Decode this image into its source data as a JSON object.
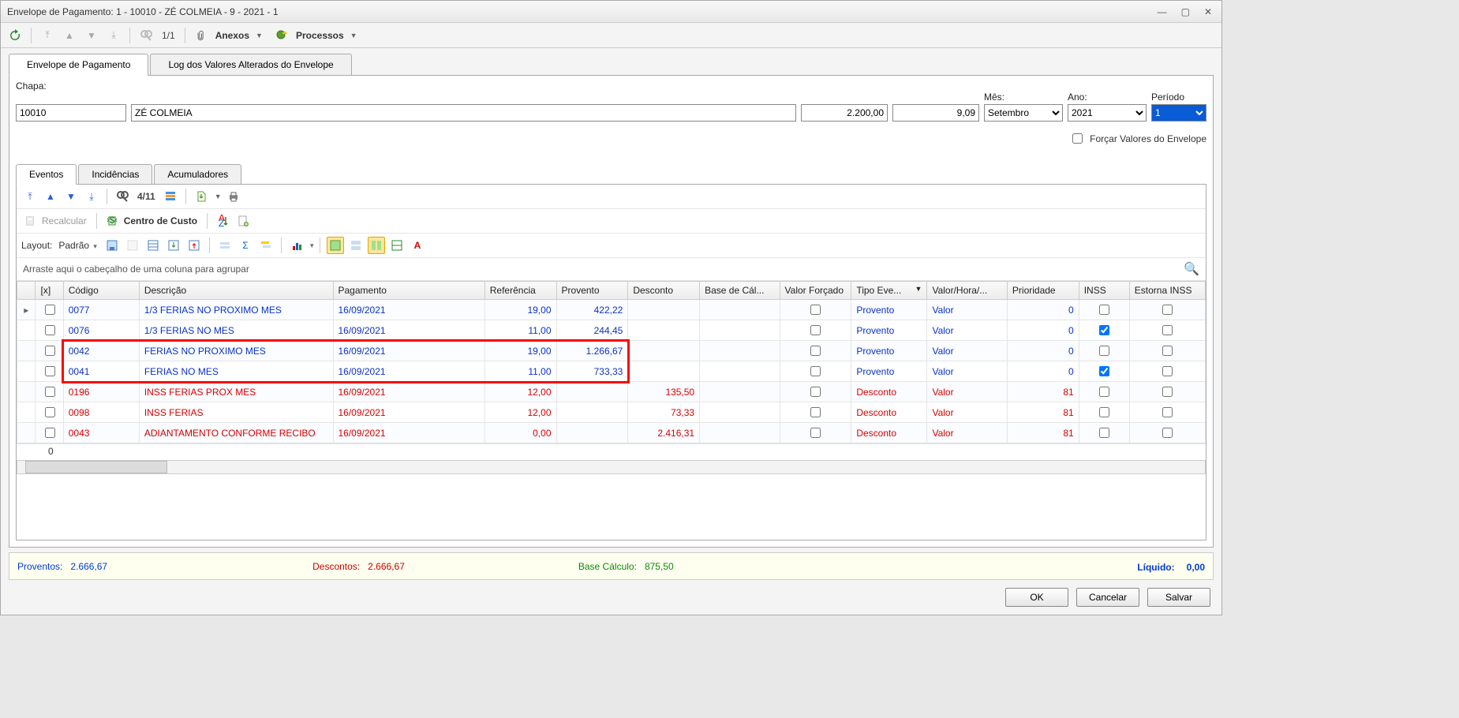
{
  "window": {
    "title": "Envelope de Pagamento: 1 - 10010 - ZÉ COLMEIA - 9 - 2021 - 1"
  },
  "toolbar": {
    "page_indicator": "1/1",
    "anexos_label": "Anexos",
    "processos_label": "Processos"
  },
  "main_tabs": {
    "tab1": "Envelope de Pagamento",
    "tab2": "Log dos Valores Alterados do Envelope"
  },
  "header": {
    "chapa_label": "Chapa:",
    "chapa_value": "10010",
    "nome_value": "ZÉ COLMEIA",
    "val1": "2.200,00",
    "val2": "9,09",
    "mes_label": "Mês:",
    "mes_value": "Setembro",
    "ano_label": "Ano:",
    "ano_value": "2021",
    "periodo_label": "Período",
    "periodo_value": "1",
    "forcar_label": "Forçar Valores do Envelope"
  },
  "sub_tabs": {
    "eventos": "Eventos",
    "incidencias": "Incidências",
    "acumuladores": "Acumuladores"
  },
  "grid_toolbar": {
    "record_indicator": "4/11",
    "recalcular": "Recalcular",
    "centro_custo": "Centro de Custo",
    "layout_label": "Layout:",
    "layout_value": "Padrão"
  },
  "group_row": "Arraste aqui o cabeçalho de uma coluna para agrupar",
  "columns": {
    "x": "[x]",
    "codigo": "Código",
    "descricao": "Descrição",
    "pagamento": "Pagamento",
    "referencia": "Referência",
    "provento": "Provento",
    "desconto": "Desconto",
    "base": "Base de Cál...",
    "forcado": "Valor Forçado",
    "tipo": "Tipo Eve...",
    "valorhora": "Valor/Hora/...",
    "prioridade": "Prioridade",
    "inss": "INSS",
    "estorna": "Estorna INSS"
  },
  "rows": [
    {
      "kind": "blue",
      "codigo": "0077",
      "descricao": "1/3 FERIAS NO PROXIMO MES",
      "pagamento": "16/09/2021",
      "referencia": "19,00",
      "provento": "422,22",
      "desconto": "",
      "forcado": false,
      "tipo": "Provento",
      "valorhora": "Valor",
      "prioridade": "0",
      "inss": false,
      "estorna": false
    },
    {
      "kind": "blue",
      "codigo": "0076",
      "descricao": "1/3 FERIAS NO MES",
      "pagamento": "16/09/2021",
      "referencia": "11,00",
      "provento": "244,45",
      "desconto": "",
      "forcado": false,
      "tipo": "Provento",
      "valorhora": "Valor",
      "prioridade": "0",
      "inss": true,
      "estorna": false
    },
    {
      "kind": "blue",
      "codigo": "0042",
      "descricao": "FERIAS NO PROXIMO MES",
      "pagamento": "16/09/2021",
      "referencia": "19,00",
      "provento": "1.266,67",
      "desconto": "",
      "forcado": false,
      "tipo": "Provento",
      "valorhora": "Valor",
      "prioridade": "0",
      "inss": false,
      "estorna": false
    },
    {
      "kind": "blue",
      "codigo": "0041",
      "descricao": "FERIAS NO MES",
      "pagamento": "16/09/2021",
      "referencia": "11,00",
      "provento": "733,33",
      "desconto": "",
      "forcado": false,
      "tipo": "Provento",
      "valorhora": "Valor",
      "prioridade": "0",
      "inss": true,
      "estorna": false
    },
    {
      "kind": "red",
      "codigo": "0196",
      "descricao": "INSS FERIAS PROX MES",
      "pagamento": "16/09/2021",
      "referencia": "12,00",
      "provento": "",
      "desconto": "135,50",
      "forcado": false,
      "tipo": "Desconto",
      "valorhora": "Valor",
      "prioridade": "81",
      "inss": false,
      "estorna": false
    },
    {
      "kind": "red",
      "codigo": "0098",
      "descricao": "INSS FERIAS",
      "pagamento": "16/09/2021",
      "referencia": "12,00",
      "provento": "",
      "desconto": "73,33",
      "forcado": false,
      "tipo": "Desconto",
      "valorhora": "Valor",
      "prioridade": "81",
      "inss": false,
      "estorna": false
    },
    {
      "kind": "red",
      "codigo": "0043",
      "descricao": "ADIANTAMENTO CONFORME RECIBO",
      "pagamento": "16/09/2021",
      "referencia": "0,00",
      "provento": "",
      "desconto": "2.416,31",
      "forcado": false,
      "tipo": "Desconto",
      "valorhora": "Valor",
      "prioridade": "81",
      "inss": false,
      "estorna": false
    }
  ],
  "total_row": "0",
  "summary": {
    "proventos_label": "Proventos:",
    "proventos_value": "2.666,67",
    "descontos_label": "Descontos:",
    "descontos_value": "2.666,67",
    "base_label": "Base Cálculo:",
    "base_value": "875,50",
    "liquido_label": "Líquido:",
    "liquido_value": "0,00"
  },
  "buttons": {
    "ok": "OK",
    "cancelar": "Cancelar",
    "salvar": "Salvar"
  }
}
